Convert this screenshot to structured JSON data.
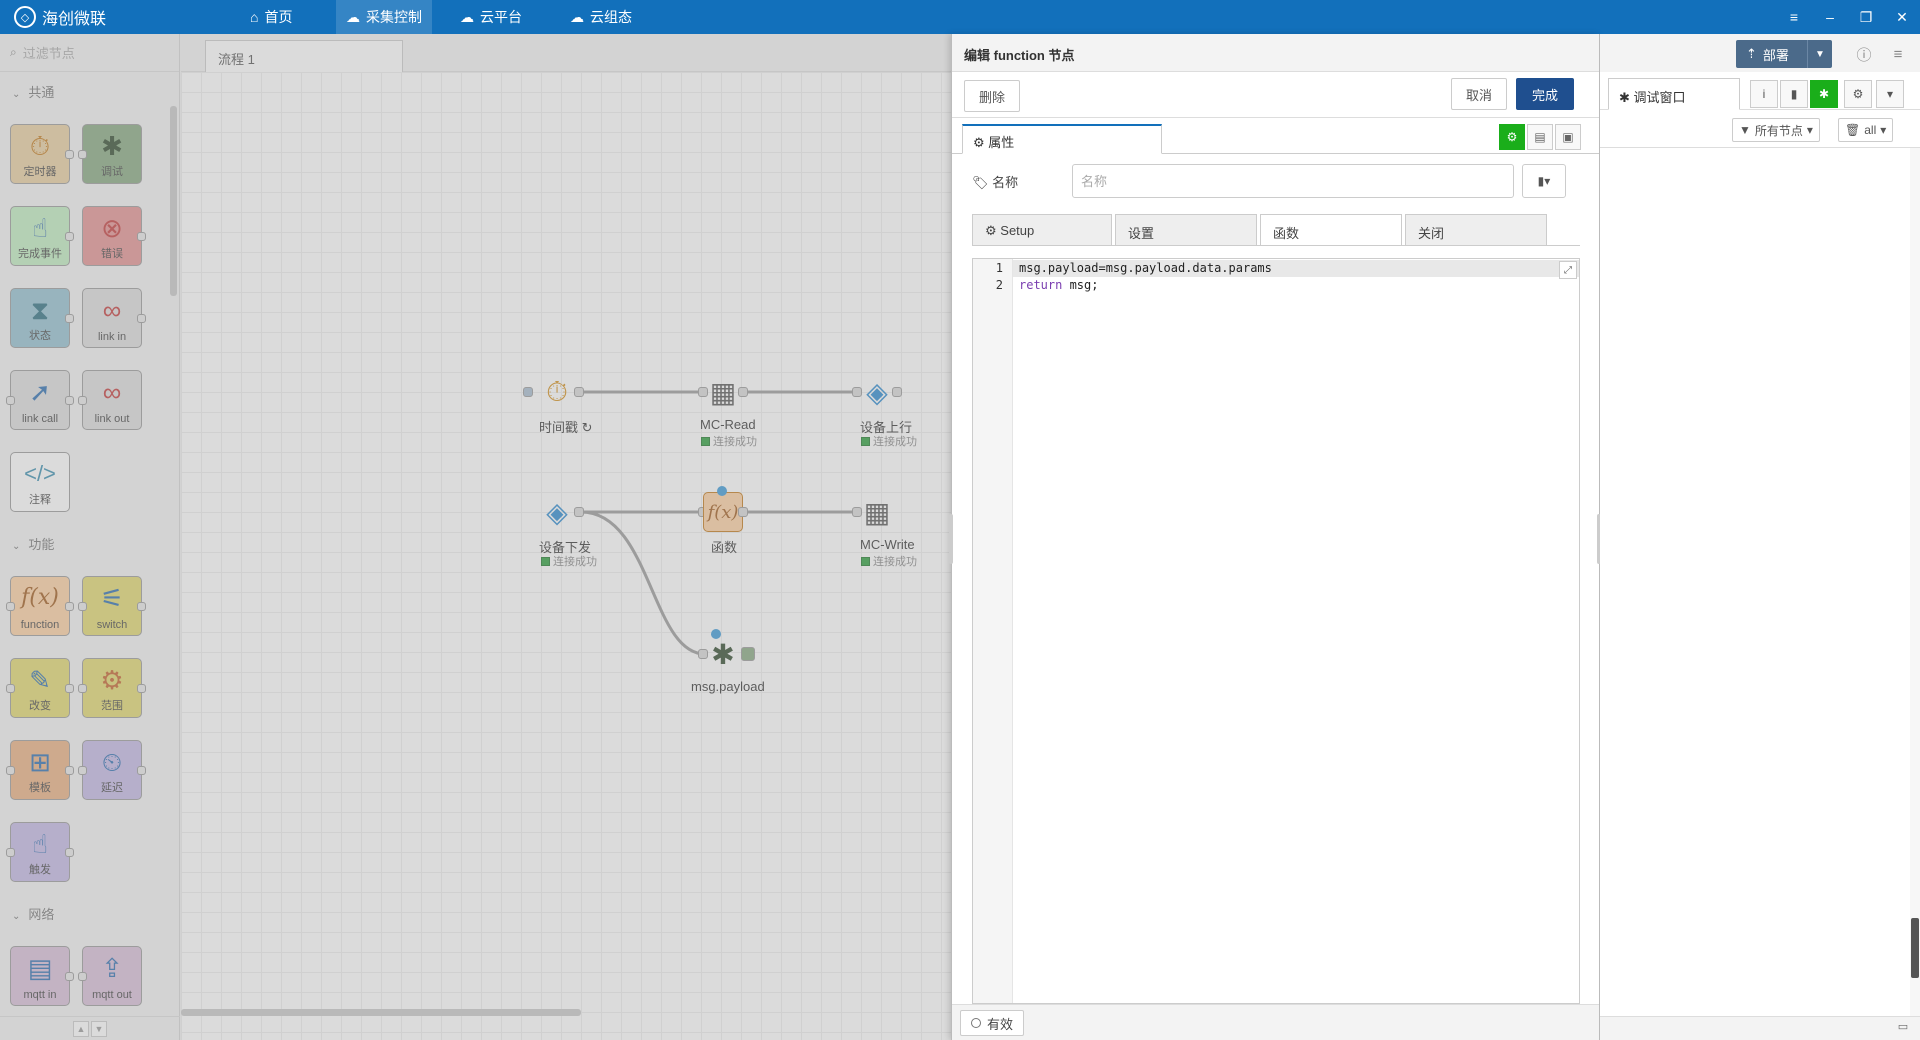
{
  "app": {
    "brand": "海创微联"
  },
  "nav": {
    "items": [
      {
        "label": "首页",
        "icon": "home-icon"
      },
      {
        "label": "采集控制",
        "icon": "cloud-gear-icon"
      },
      {
        "label": "云平台",
        "icon": "cloud-platform-icon"
      },
      {
        "label": "云组态",
        "icon": "cloud-config-icon"
      }
    ],
    "active": "采集控制"
  },
  "palette": {
    "filter_placeholder": "过滤节点",
    "categories": [
      "共通",
      "功能",
      "网络"
    ],
    "nodes": {
      "timer": "定时器",
      "debug": "调试",
      "complete": "完成事件",
      "catch": "错误",
      "status": "状态",
      "link_in": "link in",
      "link_call": "link call",
      "link_out": "link out",
      "comment": "注释",
      "function": "function",
      "switch": "switch",
      "change": "改变",
      "range": "范围",
      "template": "模板",
      "delay": "延迟",
      "trigger": "触发",
      "mqtt_in": "mqtt in",
      "mqtt_out": "mqtt out"
    }
  },
  "workspace": {
    "tab": "流程 1",
    "nodes": {
      "timestamp": "时间戳 ↻",
      "mc_read": "MC-Read",
      "device_up": "设备上行",
      "device_down": "设备下发",
      "function": "函数",
      "mc_write": "MC-Write",
      "debug": "msg.payload"
    },
    "status_text": "连接成功"
  },
  "tray": {
    "title": "编辑 function 节点",
    "delete_label": "删除",
    "cancel_label": "取消",
    "done_label": "完成",
    "properties_tab": "属性",
    "name_label": "名称",
    "name_placeholder": "名称",
    "subtabs": [
      "Setup",
      "设置",
      "函数",
      "关闭"
    ],
    "active_subtab": "函数",
    "code_lines": [
      "msg.payload=msg.payload.data.params",
      "return msg;"
    ],
    "line_numbers": [
      "1",
      "2"
    ],
    "enabled_label": "有效"
  },
  "sidebar": {
    "deploy_label": "部署",
    "tab_label": "调试窗口",
    "filter_label": "所有节点",
    "clear_label": "all"
  },
  "colors": {
    "topbar": "#1270bb",
    "primary_button": "#1f4f8f",
    "active_green": "#1aae1a",
    "deploy": "#4b6a8a"
  }
}
